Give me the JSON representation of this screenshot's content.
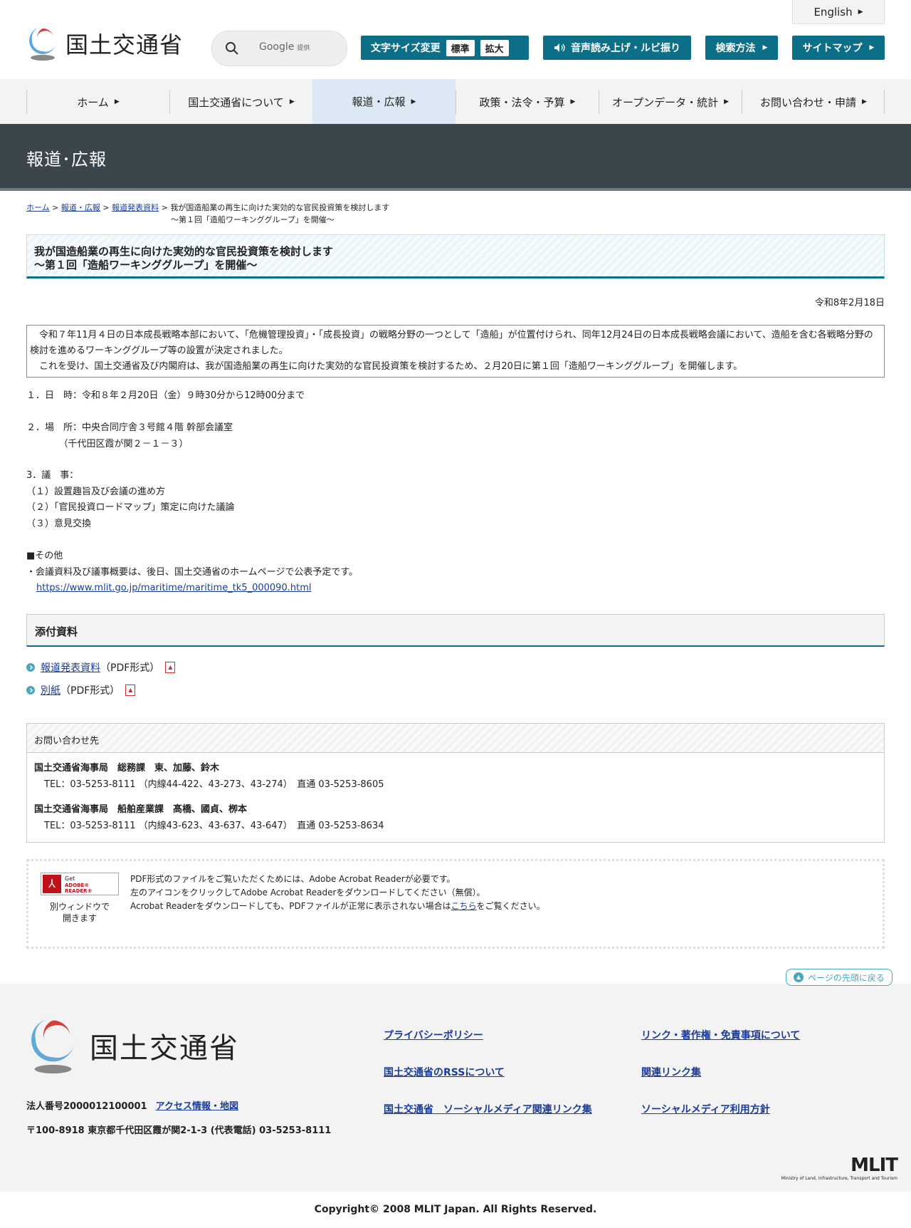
{
  "header": {
    "logo_text": "国土交通省",
    "search_text": "Google",
    "search_sub": "提供",
    "font_size_label": "文字サイズ変更",
    "font_standard": "標準",
    "font_large": "拡大",
    "voice_label": "音声読み上げ・ルビ振り",
    "search_method": "検索方法",
    "sitemap": "サイトマップ",
    "english": "English"
  },
  "nav": {
    "items": [
      {
        "label": "ホーム"
      },
      {
        "label": "国土交通省について"
      },
      {
        "label": "報道・広報"
      },
      {
        "label": "政策・法令・予算"
      },
      {
        "label": "オープンデータ・統計"
      },
      {
        "label": "お問い合わせ・申請"
      }
    ]
  },
  "page_title": "報道･広報",
  "breadcrumb": {
    "home": "ホーム",
    "press": "報道・広報",
    "release": "報道発表資料",
    "sep": ">",
    "current_line1": "我が国造船業の再生に向けた実効的な官民投資策を検討します",
    "current_line2": "～第１回「造船ワーキンググループ」を開催～"
  },
  "article": {
    "title_line1": "我が国造船業の再生に向けた実効的な官民投資策を検討します",
    "title_line2": "～第１回「造船ワーキンググループ」を開催～",
    "date": "令和8年2月18日",
    "summary_p1": "令和７年11月４日の日本成長戦略本部において、「危機管理投資」・「成長投資」の戦略分野の一つとして「造船」が位置付けられ、同年12月24日の日本成長戦略会議において、造船を含む各戦略分野の検討を進めるワーキンググループ等の設置が決定されました。",
    "summary_p2": "これを受け、国土交通省及び内閣府は、我が国造船業の再生に向けた実効的な官民投資策を検討するため、２月20日に第１回「造船ワーキンググループ」を開催します。",
    "sec1": "１．日　時：令和８年２月20日（金）９時30分から12時00分まで",
    "sec2_line1": "２．場　所：中央合同庁舎３号館４階 幹部会議室",
    "sec2_line2": "　　　　（千代田区霞が関２－１－３）",
    "sec3_head": "3．議　事：",
    "sec3_items": [
      "（１）設置趣旨及び会議の進め方",
      "（２）「官民投資ロードマップ」策定に向けた議論",
      "（３）意見交換"
    ],
    "other_head": "■その他",
    "other_text": "・会議資料及び議事概要は、後日、国土交通省のホームページで公表予定です。",
    "other_link": "https://www.mlit.go.jp/maritime/maritime_tk5_000090.html"
  },
  "attachments": {
    "heading": "添付資料",
    "items": [
      {
        "link": "報道発表資料",
        "format": "（PDF形式）"
      },
      {
        "link": "別紙",
        "format": "（PDF形式）"
      }
    ]
  },
  "contact": {
    "heading": "お問い合わせ先",
    "entries": [
      {
        "org": "国土交通省海事局　総務課　東、加藤、鈴木",
        "tel": "TEL：03-5253-8111 （内線44-422、43-273、43-274）　直通 03-5253-8605"
      },
      {
        "org": "国土交通省海事局　船舶産業課　髙橋、國貞、栁本",
        "tel": "TEL：03-5253-8111 （内線43-623、43-637、43-647）　直通 03-5253-8634"
      }
    ]
  },
  "adobe": {
    "badge_line1": "Get",
    "badge_line2": "ADOBE® READER®",
    "caption_line1": "別ウィンドウで",
    "caption_line2": "開きます",
    "line1": "PDF形式のファイルをご覧いただくためには、Adobe Acrobat Readerが必要です。",
    "line2": "左のアイコンをクリックしてAdobe Acrobat Readerをダウンロードしてください（無償）。",
    "line3_pre": "Acrobat Readerをダウンロードしても、PDFファイルが正常に表示されない場合は",
    "line3_link": "こちら",
    "line3_post": "をご覧ください。"
  },
  "pagetop": "ページの先頭に戻る",
  "footer": {
    "logo_text": "国土交通省",
    "corp_no": "法人番号2000012100001",
    "access": "アクセス情報・地図",
    "address": "〒100-8918 東京都千代田区霞が関2-1-3 (代表電話) 03-5253-8111",
    "links": [
      "プライバシーポリシー",
      "リンク・著作権・免責事項について",
      "国土交通省のRSSについて",
      "関連リンク集",
      "国土交通省　ソーシャルメディア関連リンク集",
      "ソーシャルメディア利用方針"
    ],
    "mlit": "MLIT",
    "mlit_sub": "Ministry of Land, Infrastructure, Transport and Tourism",
    "copyright": "Copyright© 2008 MLIT Japan. All Rights Reserved."
  },
  "colors": {
    "accent": "#0a6f87",
    "band": "#3a454c",
    "nav_active": "#dce9f4",
    "link": "#1a3d9c"
  }
}
